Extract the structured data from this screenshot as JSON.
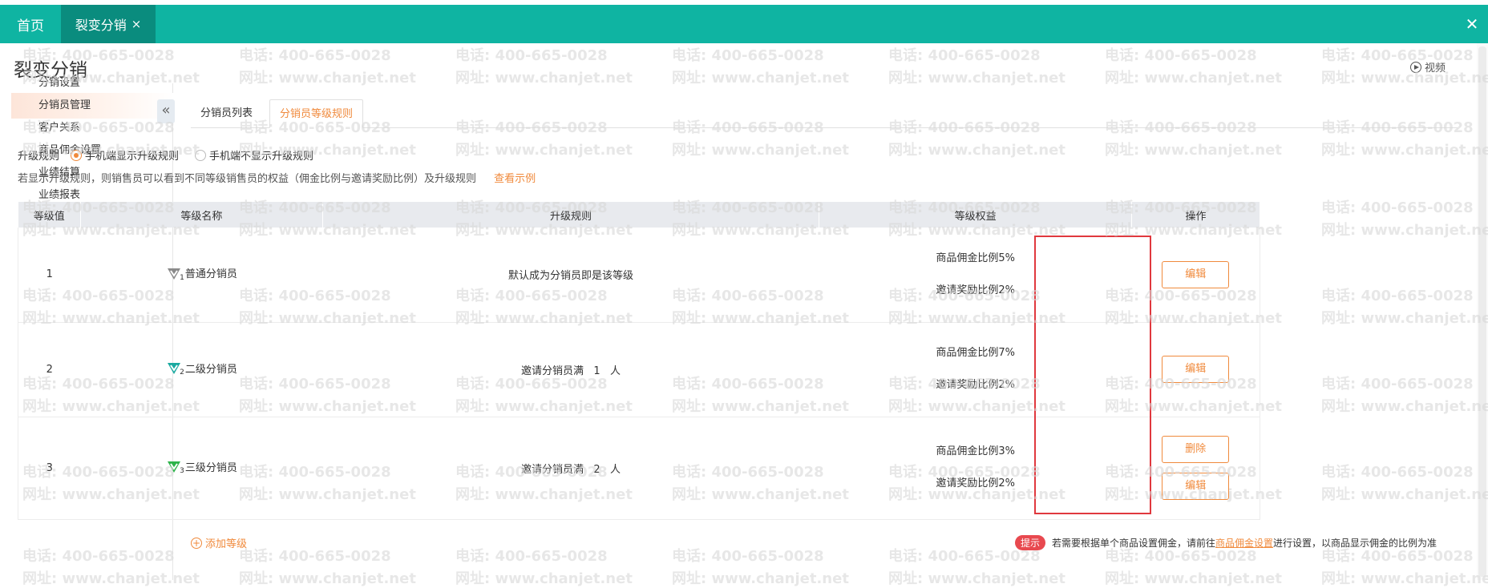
{
  "topbar": {
    "home_label": "首页",
    "active_tab": "裂变分销",
    "tab_close": "×",
    "window_close": "✕",
    "bg_color": "#0fb4a2"
  },
  "page": {
    "title": "裂变分销",
    "video_label": "视频"
  },
  "sidebar": {
    "items": [
      {
        "label": "分销设置"
      },
      {
        "label": "分销员管理"
      },
      {
        "label": "客户关系"
      },
      {
        "label": "商品佣金设置"
      },
      {
        "label": "业绩结算"
      },
      {
        "label": "业绩报表"
      }
    ],
    "collapse": "«"
  },
  "tabs": [
    {
      "label": "分销员列表"
    },
    {
      "label": "分销员等级规则"
    }
  ],
  "upgrade": {
    "label": "升级规则",
    "option_show": "手机端显示升级规则",
    "option_hide": "手机端不显示升级规则",
    "hint": "若显示升级规则，则销售员可以看到不同等级销售员的权益（佣金比例与邀请奖励比例）及升级规则",
    "example_link": "查看示例"
  },
  "table": {
    "headers": [
      "等级值",
      "等级名称",
      "升级规则",
      "等级权益",
      "操作"
    ],
    "rows": [
      {
        "level": "1",
        "name": "普通分销员",
        "badge_sub": "1",
        "badge_color": "#8a8a8a",
        "rule": "默认成为分销员即是该等级",
        "commission": "商品佣金比例5%",
        "invite": "邀请奖励比例2%",
        "actions": [
          "编辑"
        ]
      },
      {
        "level": "2",
        "name": "二级分销员",
        "badge_sub": "2",
        "badge_color": "#1aa9a0",
        "rule": "邀请分销员满   1   人",
        "commission": "商品佣金比例7%",
        "invite": "邀请奖励比例2%",
        "actions": [
          "编辑"
        ]
      },
      {
        "level": "3",
        "name": "三级分销员",
        "badge_sub": "3",
        "badge_color": "#2db34a",
        "rule": "邀请分销员满   2   人",
        "commission": "商品佣金比例3%",
        "invite": "邀请奖励比例2%",
        "actions": [
          "删除",
          "编辑"
        ]
      }
    ]
  },
  "footer": {
    "add_level": "添加等级",
    "tip_badge": "提示",
    "tip_text_before": "若需要根据单个商品设置佣金，请前往",
    "tip_link": "商品佣金设置",
    "tip_text_after": "进行设置，以商品显示佣金的比例为准"
  },
  "watermark": {
    "phone": "电话: 400-665-0028",
    "site": "网址: www.chanjet.net"
  }
}
